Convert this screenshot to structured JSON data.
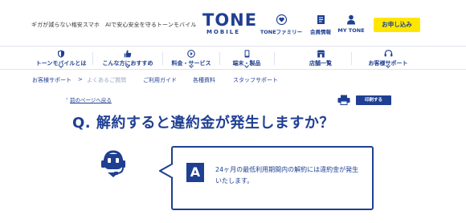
{
  "header": {
    "tagline": "ギガが減らない格安スマホ　AIで安心安全を守るトーンモバイル",
    "logo_main": "TONE",
    "logo_sub": "MOBILE",
    "links": [
      {
        "label": "TONEファミリー",
        "icon": "heart-icon"
      },
      {
        "label": "会員情報",
        "icon": "document-icon"
      },
      {
        "label": "MY TONE",
        "icon": "person-icon"
      }
    ],
    "cta_label": "お申し込み",
    "cta_color": "#ffe600"
  },
  "nav": {
    "items": [
      {
        "label": "トーンモバイルとは",
        "icon": "shield-icon"
      },
      {
        "label": "こんな方におすすめ",
        "icon": "thumb-icon"
      },
      {
        "label": "料金・サービス",
        "icon": "play-circle-icon"
      },
      {
        "label": "端末・製品",
        "icon": "smartphone-icon"
      },
      {
        "label": "店舗一覧",
        "icon": "store-icon"
      },
      {
        "label": "お客様サポート",
        "icon": "headset-icon"
      }
    ]
  },
  "subnav": {
    "items": [
      "お客様サポート",
      "よくあるご質問",
      "ご利用ガイド",
      "各種資料",
      "スタッフサポート"
    ],
    "separator": ">"
  },
  "page": {
    "back_label": "前のページへ戻る",
    "print_label": "印刷する",
    "question": "Q. 解約すると違約金が発生しますか？",
    "answer_badge": "A",
    "answer_text": "24ヶ月の最低利用期間内の解約には違約金が発生いたします。"
  },
  "colors": {
    "brand": "#1f3f92",
    "border": "#dfe4ee"
  }
}
